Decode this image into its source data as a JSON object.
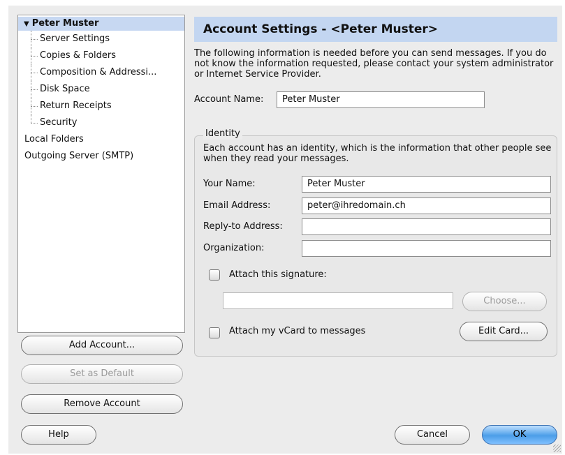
{
  "tree": {
    "account": "Peter Muster",
    "children": [
      "Server Settings",
      "Copies & Folders",
      "Composition & Addressi...",
      "Disk Space",
      "Return Receipts",
      "Security"
    ],
    "roots": [
      "Local Folders",
      "Outgoing Server (SMTP)"
    ]
  },
  "left_buttons": {
    "add": "Add Account...",
    "set_default": "Set as Default",
    "remove": "Remove Account"
  },
  "panel": {
    "title": "Account Settings - <Peter Muster>",
    "intro": "The following information is needed before you can send messages. If you do not know the information requested, please contact your system administrator or Internet Service Provider.",
    "account_name_label": "Account Name:",
    "account_name_value": "Peter Muster"
  },
  "identity": {
    "group_title": "Identity",
    "description": "Each account has an identity, which is the information that other people see when they read your messages.",
    "your_name_label": "Your Name:",
    "your_name_value": "Peter Muster",
    "email_label": "Email Address:",
    "email_value": "peter@ihredomain.ch",
    "reply_label": "Reply-to Address:",
    "reply_value": "",
    "org_label": "Organization:",
    "org_value": "",
    "signature_label": "Attach this signature:",
    "signature_path": "",
    "choose_label": "Choose...",
    "vcard_label": "Attach my vCard to messages",
    "edit_card_label": "Edit Card..."
  },
  "footer": {
    "help": "Help",
    "cancel": "Cancel",
    "ok": "OK"
  },
  "colors": {
    "selection": "#c7d8f2",
    "banner": "#c3d6f1",
    "primary_button": "#4c9ee8"
  }
}
